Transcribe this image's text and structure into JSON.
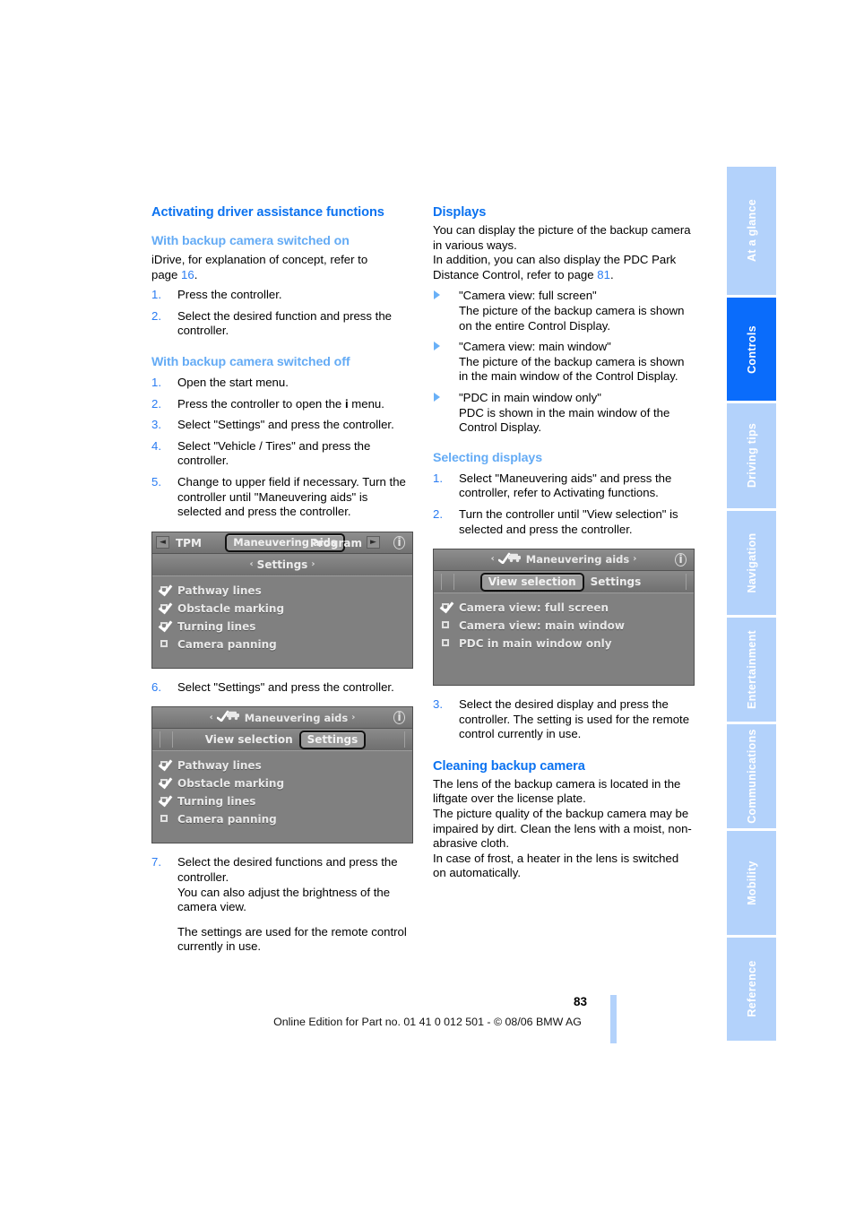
{
  "document": {
    "page_number": "83",
    "footer": "Online Edition for Part no. 01 41 0 012 501 - © 08/06 BMW AG"
  },
  "sidebar": {
    "tabs": [
      {
        "label": "At a glance",
        "active": false
      },
      {
        "label": "Controls",
        "active": true
      },
      {
        "label": "Driving tips",
        "active": false
      },
      {
        "label": "Navigation",
        "active": false
      },
      {
        "label": "Entertainment",
        "active": false
      },
      {
        "label": "Communications",
        "active": false
      },
      {
        "label": "Mobility",
        "active": false
      },
      {
        "label": "Reference",
        "active": false
      }
    ],
    "active_color": "#0a6cfb",
    "inactive_color": "#b3d2fb"
  },
  "left_column": {
    "heading": "Activating driver assistance functions",
    "sub1": {
      "heading": "With backup camera switched on",
      "intro_a": "iDrive, for explanation of concept, refer to",
      "intro_b": "page ",
      "page_ref": "16",
      "intro_c": ".",
      "steps": [
        {
          "num": "1.",
          "text": "Press the controller."
        },
        {
          "num": "2.",
          "text": "Select the desired function and press the controller."
        }
      ]
    },
    "sub2": {
      "heading": "With backup camera switched off",
      "steps": [
        {
          "num": "1.",
          "text": "Open the start menu."
        },
        {
          "num": "2.",
          "text": "Press the controller to open the i menu.",
          "text_pre": "Press the controller to open the ",
          "text_post": " menu.",
          "icon": "i"
        },
        {
          "num": "3.",
          "text": "Select \"Settings\" and press the controller."
        },
        {
          "num": "4.",
          "text": "Select \"Vehicle / Tires\" and press the controller."
        },
        {
          "num": "5.",
          "text": "Change to upper field if necessary. Turn the controller until \"Maneuvering aids\" is selected and press the controller."
        }
      ],
      "step6": {
        "num": "6.",
        "text": "Select \"Settings\" and press the controller."
      },
      "step7": {
        "num": "7.",
        "text": "Select the desired functions and press the controller.",
        "sub_a": "You can also adjust the brightness of the camera view.",
        "sub_b": "The settings are used for the remote control currently in use."
      }
    },
    "screenshot1": {
      "nav_left": "◄",
      "nav_right": "►",
      "tab_prev": "TPM",
      "tab_selected": "Maneuvering aids",
      "tab_next": "Program",
      "info_icon": "i",
      "subtitle": "Settings",
      "subtitle_arrow_left": "‹",
      "subtitle_arrow_right": "›",
      "items": [
        {
          "label": "Pathway lines",
          "checked": true
        },
        {
          "label": "Obstacle marking",
          "checked": true
        },
        {
          "label": "Turning lines",
          "checked": true
        },
        {
          "label": "Camera panning",
          "checked": false
        }
      ]
    },
    "screenshot2": {
      "title": "Maneuvering aids",
      "arrow_left": "‹",
      "arrow_right": "›",
      "info_icon": "i",
      "tab_unselected": "View selection",
      "tab_selected": "Settings",
      "items": [
        {
          "label": "Pathway lines",
          "checked": true
        },
        {
          "label": "Obstacle marking",
          "checked": true
        },
        {
          "label": "Turning lines",
          "checked": true
        },
        {
          "label": "Camera panning",
          "checked": false
        }
      ]
    }
  },
  "right_column": {
    "displays": {
      "heading": "Displays",
      "para1": "You can display the picture of the backup camera in various ways.",
      "para2_a": "In addition, you can also display the PDC Park Distance Control, refer to page ",
      "para2_ref": "81",
      "para2_b": ".",
      "bullets": [
        {
          "title": "\"Camera view: full screen\"",
          "desc": "The picture of the backup camera is shown on the entire Control Display."
        },
        {
          "title": "\"Camera view: main window\"",
          "desc": "The picture of the backup camera is shown in the main window of the Control Display."
        },
        {
          "title": "\"PDC in main window only\"",
          "desc": "PDC is shown in the main window of the Control Display."
        }
      ]
    },
    "selecting_displays": {
      "heading": "Selecting displays",
      "steps": [
        {
          "num": "1.",
          "text": "Select \"Maneuvering aids\" and press the controller, refer to Activating functions."
        },
        {
          "num": "2.",
          "text": "Turn the controller until \"View selection\" is selected and press the controller."
        }
      ],
      "step3": {
        "num": "3.",
        "text": "Select the desired display and press the controller. The setting is used for the remote control currently in use."
      }
    },
    "screenshot": {
      "title": "Maneuvering aids",
      "arrow_left": "‹",
      "arrow_right": "›",
      "info_icon": "i",
      "tab_selected": "View selection",
      "tab_unselected": "Settings",
      "items": [
        {
          "label": "Camera view: full screen",
          "checked": true
        },
        {
          "label": "Camera view: main window",
          "checked": false
        },
        {
          "label": "PDC in main window only",
          "checked": false
        }
      ]
    },
    "cleaning": {
      "heading": "Cleaning backup camera",
      "para1": "The lens of the backup camera is located in the liftgate over the license plate.",
      "para2": "The picture quality of the backup camera may be impaired by dirt. Clean the lens with a moist, non-abrasive cloth.",
      "para3": "In case of frost, a heater in the lens is switched on automatically."
    }
  }
}
